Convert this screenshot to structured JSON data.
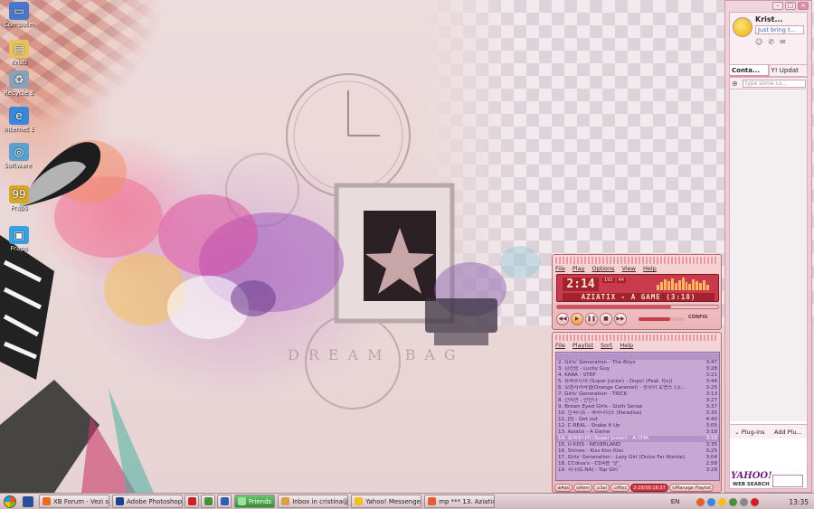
{
  "desktop": {
    "icons": [
      {
        "label": "Computer",
        "icon": "computer-icon",
        "color": "#4a78c8"
      },
      {
        "label": "Kristi",
        "icon": "user-folder-icon",
        "color": "#e7c35a"
      },
      {
        "label": "Recycle Bin",
        "icon": "recycle-bin-icon",
        "color": "#8aa0b8"
      },
      {
        "label": "Internet Explorer",
        "icon": "ie-icon",
        "color": "#3a86d8"
      },
      {
        "label": "Software Gate",
        "icon": "software-icon",
        "color": "#58a0d0"
      },
      {
        "label": "Fraps",
        "icon": "fraps-icon",
        "color": "#d6a72b"
      },
      {
        "label": "Fraps",
        "icon": "app-icon",
        "color": "#3aa0e0"
      }
    ]
  },
  "yahoo": {
    "name": "Krist...",
    "status": "Just bring t...",
    "tabs": [
      "Conta...",
      "Y! Updat"
    ],
    "search_placeholder": "type some co...",
    "plugins_label": "Plug-ins",
    "add_plugins_label": "Add Plu...",
    "logo": "YAHOO!",
    "web_search": "WEB SEARCH"
  },
  "winamp": {
    "menu": [
      "File",
      "Play",
      "Options",
      "View",
      "Help"
    ],
    "time": "2:14",
    "kbps": "192",
    "khz": "44",
    "track_display": "AZIATIX - A GAME (3:18)",
    "progress_fraction": 0.71,
    "volume_fraction": 0.7,
    "config_label": "CONFIG",
    "controls": [
      "◀◀",
      "▶",
      "❚❚",
      "■",
      "▶▶"
    ]
  },
  "playlist": {
    "menu": [
      "File",
      "Playlist",
      "Sort",
      "Help"
    ],
    "highlight_index": 13,
    "tracks": [
      {
        "title": "",
        "duration": ""
      },
      {
        "title": "2. Girls' Generation - The Boys",
        "duration": "3:47"
      },
      {
        "title": "3. 김현중 - Lucky Guy",
        "duration": "3:28"
      },
      {
        "title": "4. KARA - STEP",
        "duration": "3:21"
      },
      {
        "title": "5. 슈퍼주니어 (Super Junior) - Oops! (Feat. f(x))",
        "duration": "3:44"
      },
      {
        "title": "6. 오렌지캬라멜(Orange Caramel) - 상하이 로맨스 (上...",
        "duration": "3:25"
      },
      {
        "title": "7. Girls' Generation - TRICK",
        "duration": "3:13"
      },
      {
        "title": "8. 간미연 - 안만나",
        "duration": "3:27"
      },
      {
        "title": "9. Brown Eyed Girls - Sixth Sense",
        "duration": "3:37"
      },
      {
        "title": "10. 인피니트 - 파라다이스 (Paradise)",
        "duration": "3:35"
      },
      {
        "title": "11. JYJ - Get out",
        "duration": "4:40"
      },
      {
        "title": "12. C-REAL - Shake It Up",
        "duration": "3:05"
      },
      {
        "title": "13. Aziatix - A Game",
        "duration": "3:18"
      },
      {
        "title": "14. 슈퍼주니어 (Super Junior) - A-CHA",
        "duration": "3:18"
      },
      {
        "title": "15. U-KISS - NEVERLAND",
        "duration": "3:35"
      },
      {
        "title": "16. Shinee - Kiss Kiss Kiss",
        "duration": "3:25"
      },
      {
        "title": "17. Girls' Generation - Lazy Girl (Dolce Far Niente)",
        "duration": "3:04"
      },
      {
        "title": "18. CCdiva's - CD4용 '핫'_",
        "duration": "2:58"
      },
      {
        "title": "19. 지나(G.NA) - Top Girl",
        "duration": "3:28"
      }
    ],
    "buttons": [
      "Add",
      "Rem",
      "Sel",
      "Misc"
    ],
    "time_total": "2:28/58:18:37",
    "manage_label": "Manage Playlist"
  },
  "taskbar": {
    "tasks": [
      {
        "label": "XB Forum - Vezi su...",
        "icon": "firefox-icon",
        "color": "#e76b1f",
        "active": false
      },
      {
        "label": "Adobe Photoshop ...",
        "icon": "photoshop-icon",
        "color": "#1c3f8e",
        "active": false
      },
      {
        "label": "",
        "icon": "app-red-icon",
        "color": "#c22",
        "active": false
      },
      {
        "label": "",
        "icon": "dreamweaver-icon",
        "color": "#4b8f3a",
        "active": false
      },
      {
        "label": "",
        "icon": "app-blue-icon",
        "color": "#2f5fb0",
        "active": false
      },
      {
        "label": "Friends",
        "icon": "friends-icon",
        "color": "#9fe09f",
        "active": true
      },
      {
        "label": "Inbox in cristina@i...",
        "icon": "mail-icon",
        "color": "#d8a040",
        "active": false
      },
      {
        "label": "Yahoo! Messenger",
        "icon": "yahoo-messenger-icon",
        "color": "#f0c020",
        "active": false
      },
      {
        "label": "mp *** 13. Aziatix -...",
        "icon": "winamp-icon",
        "color": "#e06030",
        "active": false
      }
    ],
    "language": "EN",
    "clock": "13:35"
  }
}
